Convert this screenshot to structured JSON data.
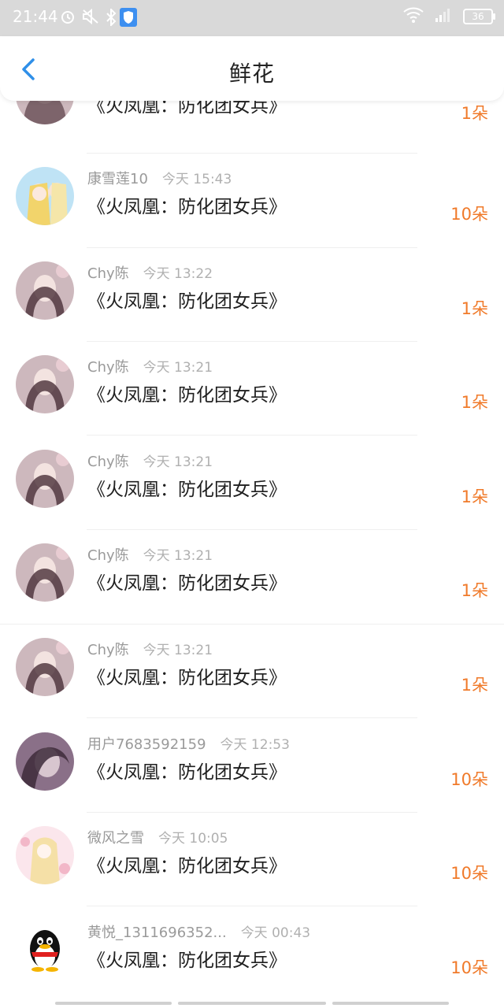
{
  "status_bar": {
    "time": "21:44",
    "battery": "36"
  },
  "header": {
    "title": "鲜花"
  },
  "items": [
    {
      "user": "",
      "time": "",
      "book": "《火凤凰：防化团女兵》",
      "count": "1朵",
      "avatar": "portrait-dark"
    },
    {
      "user": "康雪莲10",
      "time": "今天 15:43",
      "book": "《火凤凰：防化团女兵》",
      "count": "10朵",
      "avatar": "anime-blonde"
    },
    {
      "user": "Chy陈",
      "time": "今天 13:22",
      "book": "《火凤凰：防化团女兵》",
      "count": "1朵",
      "avatar": "portrait-dark"
    },
    {
      "user": "Chy陈",
      "time": "今天 13:21",
      "book": "《火凤凰：防化团女兵》",
      "count": "1朵",
      "avatar": "portrait-dark"
    },
    {
      "user": "Chy陈",
      "time": "今天 13:21",
      "book": "《火凤凰：防化团女兵》",
      "count": "1朵",
      "avatar": "portrait-dark"
    },
    {
      "user": "Chy陈",
      "time": "今天 13:21",
      "book": "《火凤凰：防化团女兵》",
      "count": "1朵",
      "avatar": "portrait-dark"
    },
    {
      "user": "Chy陈",
      "time": "今天 13:21",
      "book": "《火凤凰：防化团女兵》",
      "count": "1朵",
      "avatar": "portrait-dark"
    },
    {
      "user": "用户7683592159",
      "time": "今天 12:53",
      "book": "《火凤凰：防化团女兵》",
      "count": "10朵",
      "avatar": "portrait-purple"
    },
    {
      "user": "微风之雪",
      "time": "今天 10:05",
      "book": "《火凤凰：防化团女兵》",
      "count": "10朵",
      "avatar": "anime-pink"
    },
    {
      "user": "黄悦_1311696352...",
      "time": "今天 00:43",
      "book": "《火凤凰：防化团女兵》",
      "count": "10朵",
      "avatar": "qq-penguin"
    }
  ],
  "colors": {
    "accent": "#f07a2a",
    "back": "#2f8fe8",
    "statusbar": "#d9d9d9"
  }
}
